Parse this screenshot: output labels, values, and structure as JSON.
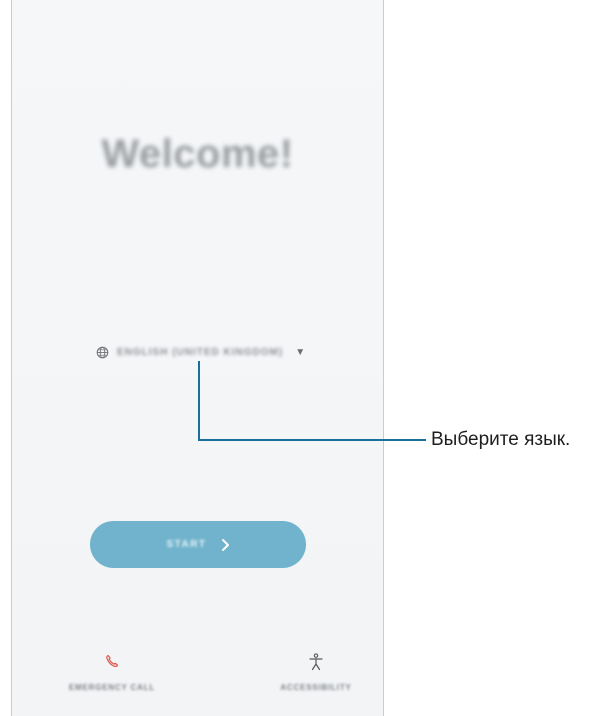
{
  "screen": {
    "welcome_title": "Welcome!",
    "language_selector": {
      "value": "ENGLISH (UNITED KINGDOM)",
      "icon": "globe-icon",
      "dropdown_icon": "caret-down-icon"
    },
    "start_button": {
      "label": "START",
      "icon": "chevron-right-icon"
    },
    "bottom": {
      "emergency_call": {
        "label": "EMERGENCY CALL",
        "icon": "phone-icon"
      },
      "accessibility": {
        "label": "ACCESSIBILITY",
        "icon": "accessibility-icon"
      }
    }
  },
  "callout": {
    "text": "Выберите язык."
  },
  "colors": {
    "accent_button": "#71b3cc",
    "callout_line": "#1a6f9c",
    "emergency_icon": "#e0574f",
    "background": "#f4f6f8"
  }
}
